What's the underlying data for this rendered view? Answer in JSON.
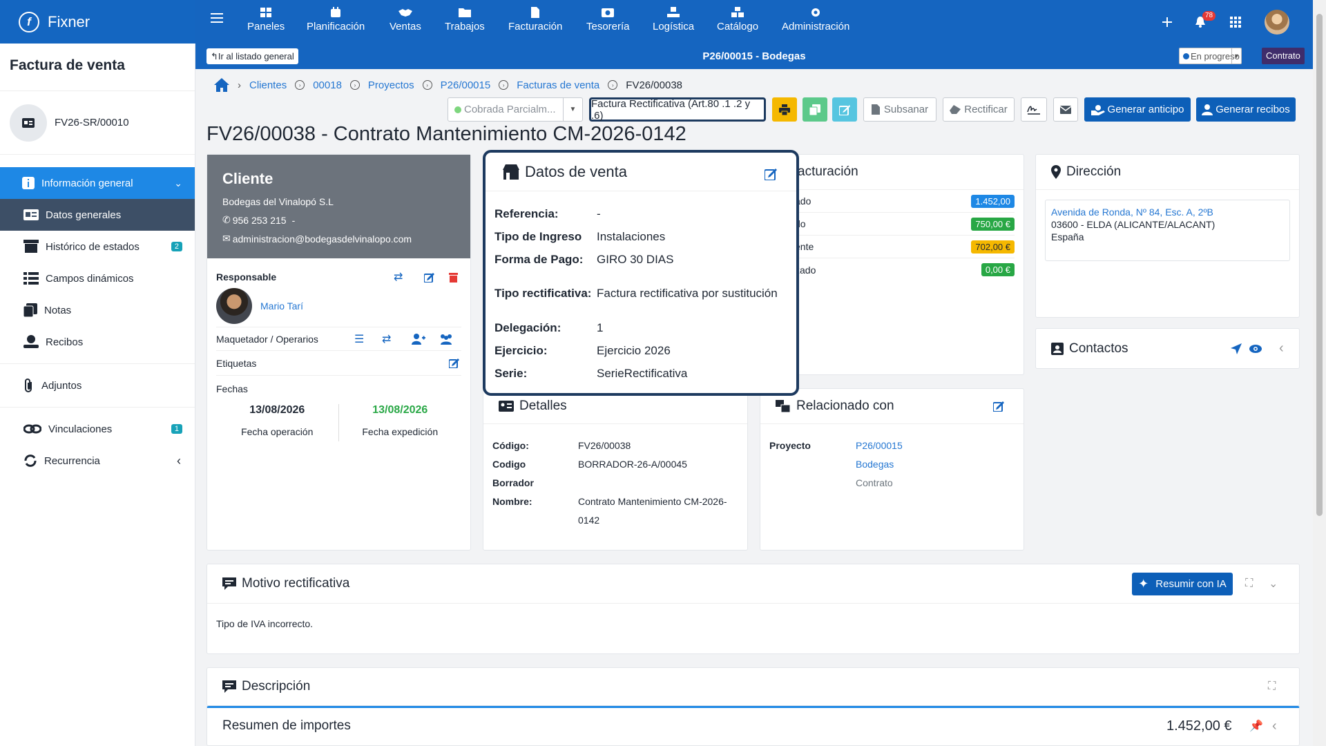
{
  "app": {
    "name": "Fixner"
  },
  "nav": [
    {
      "label": "Paneles",
      "icon": "dashboard-icon"
    },
    {
      "label": "Planificación",
      "icon": "calendar-icon"
    },
    {
      "label": "Ventas",
      "icon": "handshake-icon"
    },
    {
      "label": "Trabajos",
      "icon": "folder-icon"
    },
    {
      "label": "Facturación",
      "icon": "invoice-icon"
    },
    {
      "label": "Tesorería",
      "icon": "cash-icon"
    },
    {
      "label": "Logística",
      "icon": "logistics-icon"
    },
    {
      "label": "Catálogo",
      "icon": "catalog-icon"
    },
    {
      "label": "Administración",
      "icon": "gear-icon"
    }
  ],
  "notifications": {
    "count": "78"
  },
  "subbar": {
    "back": "Ir al listado general",
    "title": "P26/00015 - Bodegas",
    "state": "En progreso",
    "tag": "Contrato"
  },
  "sidebar": {
    "title": "Factura de venta",
    "doc": "FV26-SR/00010",
    "main": "Información general",
    "items": [
      {
        "label": "Datos generales",
        "icon": "id-card-icon"
      },
      {
        "label": "Histórico de estados",
        "icon": "archive-icon",
        "count": "2"
      },
      {
        "label": "Campos dinámicos",
        "icon": "list-icon"
      },
      {
        "label": "Notas",
        "icon": "notes-icon"
      },
      {
        "label": "Recibos",
        "icon": "receipt-icon"
      }
    ],
    "adjuntos": "Adjuntos",
    "vinculaciones": "Vinculaciones",
    "vinc_count": "1",
    "recurrencia": "Recurrencia"
  },
  "breadcrumb": [
    "Clientes",
    "00018",
    "Proyectos",
    "P26/00015",
    "Facturas de venta",
    "FV26/00038"
  ],
  "toolbar": {
    "status": "Cobrada Parcialm...",
    "type": "Factura Rectificativa (Art.80 .1 .2 y .6)",
    "subsanar": "Subsanar",
    "rectificar": "Rectificar",
    "anticipo": "Generar anticipo",
    "recibos": "Generar recibos"
  },
  "page_title": "FV26/00038 - Contrato Mantenimiento CM-2026-0142",
  "cliente": {
    "heading": "Cliente",
    "name": "Bodegas del Vinalopó S.L",
    "phone": "956 253 215",
    "phone_suffix": "-",
    "email": "administracion@bodegasdelvinalopo.com",
    "responsable_label": "Responsable",
    "responsable": "Mario Tarí",
    "operarios_label": "Maquetador / Operarios",
    "etiquetas_label": "Etiquetas",
    "fechas_label": "Fechas",
    "fecha_op": "13/08/2026",
    "fecha_op_label": "Fecha operación",
    "fecha_exp": "13/08/2026",
    "fecha_exp_label": "Fecha expedición"
  },
  "datos_venta": {
    "title": "Datos de venta",
    "rows": [
      {
        "k": "Referencia:",
        "v": "-"
      },
      {
        "k": "Tipo de Ingreso",
        "v": "Instalaciones"
      },
      {
        "k": "Forma de Pago:",
        "v": "GIRO 30 DIAS"
      },
      {
        "k": "Tipo rectificativa:",
        "v": "Factura rectificativa por sustitución"
      },
      {
        "k": "Delegación:",
        "v": "1"
      },
      {
        "k": "Ejercicio:",
        "v": "Ejercicio 2026"
      },
      {
        "k": "Serie:",
        "v": "SerieRectificativa"
      }
    ]
  },
  "facturacion": {
    "title": "acturación",
    "rows": [
      {
        "k": "ado",
        "v": "1.452,00",
        "color": "#1e88e5"
      },
      {
        "k": "do",
        "v": "750,00 €",
        "color": "#28a745"
      },
      {
        "k": "ente",
        "v": "702,00 €",
        "color": "#f5b800"
      },
      {
        "k": "zado",
        "v": "0,00 €",
        "color": "#28a745"
      }
    ]
  },
  "direccion": {
    "title": "Dirección",
    "line1": "Avenida de Ronda, Nº 84, Esc. A, 2ºB",
    "line2": "03600 - ELDA (ALICANTE/ALACANT)",
    "line3": "España"
  },
  "contactos": {
    "title": "Contactos"
  },
  "detalles": {
    "title": "Detalles",
    "codigo_k": "Código:",
    "codigo_v": "FV26/00038",
    "borrador_k1": "Codigo",
    "borrador_k2": "Borrador",
    "borrador_v": "BORRADOR-26-A/00045",
    "nombre_k": "Nombre:",
    "nombre_v1": "Contrato Mantenimiento CM-2026-",
    "nombre_v2": "0142"
  },
  "relacionado": {
    "title": "Relacionado con",
    "label": "Proyecto",
    "v1": "P26/00015",
    "v2": "Bodegas",
    "v3": "Contrato"
  },
  "motivo": {
    "title": "Motivo rectificativa",
    "button": "Resumir con IA",
    "text": "Tipo de IVA incorrecto."
  },
  "descripcion": {
    "title": "Descripción"
  },
  "resumen": {
    "title": "Resumen de importes",
    "total": "1.452,00 €"
  }
}
